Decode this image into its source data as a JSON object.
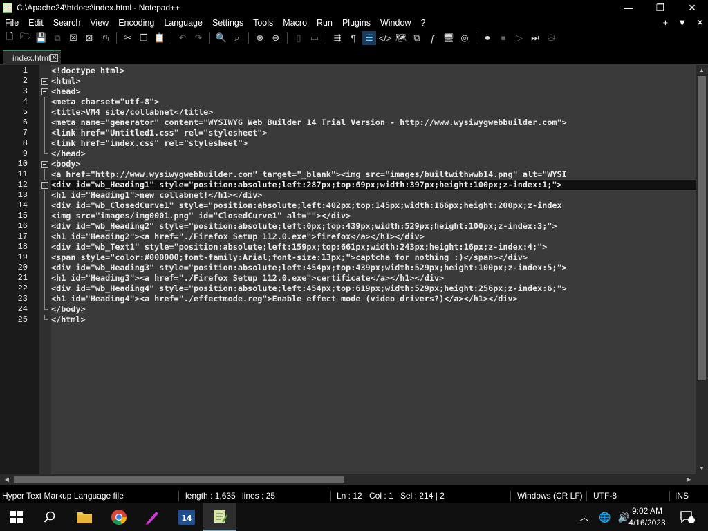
{
  "window": {
    "title": "C:\\Apache24\\htdocs\\index.html - Notepad++",
    "minimize": "—",
    "maximize": "❐",
    "close": "✕"
  },
  "menu": [
    "File",
    "Edit",
    "Search",
    "View",
    "Encoding",
    "Language",
    "Settings",
    "Tools",
    "Macro",
    "Run",
    "Plugins",
    "Window",
    "?"
  ],
  "menu_right": {
    "add": "+",
    "dropdown": "▼",
    "close": "✕"
  },
  "tab": {
    "label": "index.html",
    "close": "✕"
  },
  "line_numbers": [
    "1",
    "2",
    "3",
    "4",
    "5",
    "6",
    "7",
    "8",
    "9",
    "10",
    "11",
    "12",
    "13",
    "14",
    "15",
    "16",
    "17",
    "18",
    "19",
    "20",
    "21",
    "22",
    "23",
    "24",
    "25"
  ],
  "code": [
    "<!doctype html>",
    "<html>",
    "<head>",
    "<meta charset=\"utf-8\">",
    "<title>VM4 site/collabnet</title>",
    "<meta name=\"generator\" content=\"WYSIWYG Web Builder 14 Trial Version - http://www.wysiwygwebbuilder.com\">",
    "<link href=\"Untitled1.css\" rel=\"stylesheet\">",
    "<link href=\"index.css\" rel=\"stylesheet\">",
    "</head>",
    "<body>",
    "<a href=\"http://www.wysiwygwebbuilder.com\" target=\"_blank\"><img src=\"images/builtwithwwb14.png\" alt=\"WYSI",
    "<div id=\"wb_Heading1\" style=\"position:absolute;left:287px;top:69px;width:397px;height:100px;z-index:1;\">",
    "<h1 id=\"Heading1\">new collabnet!</h1></div>",
    "<div id=\"wb_ClosedCurve1\" style=\"position:absolute;left:402px;top:145px;width:166px;height:200px;z-index",
    "<img src=\"images/img0001.png\" id=\"ClosedCurve1\" alt=\"\"></div>",
    "<div id=\"wb_Heading2\" style=\"position:absolute;left:0px;top:439px;width:529px;height:100px;z-index:3;\">",
    "<h1 id=\"Heading2\"><a href=\"./Firefox Setup 112.0.exe\">firefox</a></h1></div>",
    "<div id=\"wb_Text1\" style=\"position:absolute;left:159px;top:661px;width:243px;height:16px;z-index:4;\">",
    "<span style=\"color:#000000;font-family:Arial;font-size:13px;\">captcha for nothing :)</span></div>",
    "<div id=\"wb_Heading3\" style=\"position:absolute;left:454px;top:439px;width:529px;height:100px;z-index:5;\">",
    "<h1 id=\"Heading3\"><a href=\"./Firefox Setup 112.0.exe\">certificate</a></h1></div>",
    "<div id=\"wb_Heading4\" style=\"position:absolute;left:454px;top:619px;width:529px;height:256px;z-index:6;\">",
    "<h1 id=\"Heading4\"><a href=\"./effectmode.reg\">Enable effect mode (video drivers?)</a></h1></div>",
    "</body>",
    "</html>"
  ],
  "fold_marks": [
    "",
    "box",
    "box",
    "line",
    "line",
    "line",
    "line",
    "line",
    "end",
    "box",
    "line",
    "box",
    "line",
    "line",
    "line",
    "line",
    "line",
    "line",
    "line",
    "line",
    "line",
    "line",
    "line",
    "end",
    "end"
  ],
  "current_line": 11,
  "status": {
    "file_type": "Hyper Text Markup Language file",
    "length": "length : 1,635",
    "lines": "lines : 25",
    "ln": "Ln : 12",
    "col": "Col : 1",
    "sel": "Sel : 214 | 2",
    "eol": "Windows (CR LF)",
    "encoding": "UTF-8",
    "mode": "INS"
  },
  "taskbar": {
    "time": "9:02 AM",
    "date": "4/16/2023",
    "notification_count": "1"
  },
  "colors": {
    "editor_bg": "#3a3a3a",
    "gutter_bg": "#1b1b1b",
    "code_text": "#e8e8e8",
    "active_tab_accent": "#3c8c6c"
  }
}
